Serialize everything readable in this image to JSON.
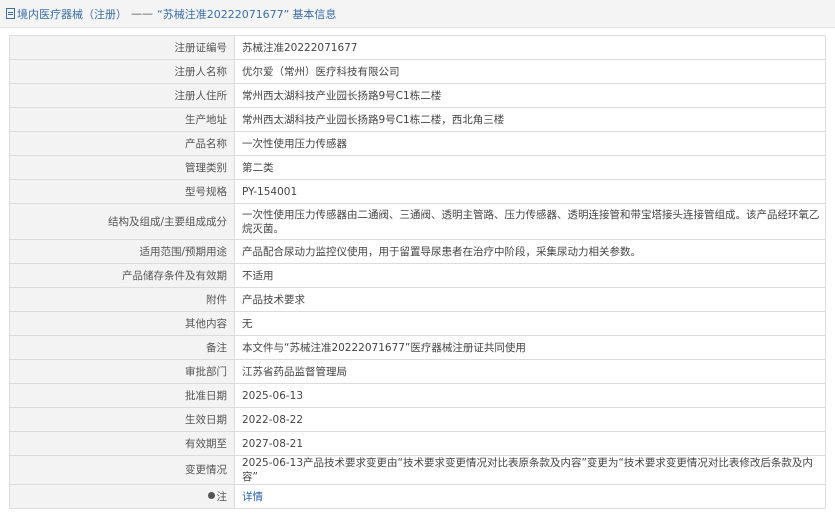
{
  "breadcrumb": {
    "section": "境内医疗器械（注册）",
    "separator": "——",
    "reg_no_quoted": "“苏械注准20222071677”",
    "suffix": "基本信息",
    "icon": "document-icon"
  },
  "rows": [
    {
      "label": "注册证编号",
      "value": "苏械注准20222071677"
    },
    {
      "label": "注册人名称",
      "value": "优尔爱（常州）医疗科技有限公司"
    },
    {
      "label": "注册人住所",
      "value": "常州西太湖科技产业园长扬路9号C1栋二楼"
    },
    {
      "label": "生产地址",
      "value": "常州西太湖科技产业园长扬路9号C1栋二楼，西北角三楼"
    },
    {
      "label": "产品名称",
      "value": "一次性使用压力传感器"
    },
    {
      "label": "管理类别",
      "value": "第二类"
    },
    {
      "label": "型号规格",
      "value": "PY-154001"
    },
    {
      "label": "结构及组成/主要组成成分",
      "value": "一次性使用压力传感器由二通阀、三通阀、透明主管路、压力传感器、透明连接管和带宝塔接头连接管组成。该产品经环氧乙烷灭菌。"
    },
    {
      "label": "适用范围/预期用途",
      "value": "产品配合尿动力监控仪使用，用于留置导尿患者在治疗中阶段，采集尿动力相关参数。"
    },
    {
      "label": "产品储存条件及有效期",
      "value": "不适用"
    },
    {
      "label": "附件",
      "value": "产品技术要求"
    },
    {
      "label": "其他内容",
      "value": "无"
    },
    {
      "label": "备注",
      "value": "本文件与“苏械注准20222071677”医疗器械注册证共同使用"
    },
    {
      "label": "审批部门",
      "value": "江苏省药品监督管理局"
    },
    {
      "label": "批准日期",
      "value": "2025-06-13"
    },
    {
      "label": "生效日期",
      "value": "2022-08-22"
    },
    {
      "label": "有效期至",
      "value": "2027-08-21"
    },
    {
      "label": "变更情况",
      "value": "2025-06-13产品技术要求变更由“技术要求变更情况对比表原条款及内容”变更为“技术要求变更情况对比表修改后条款及内容”"
    }
  ],
  "note_row": {
    "label": "注",
    "icon": "pin-icon",
    "link_text": "详情",
    "link_color": "#2a64b0"
  }
}
